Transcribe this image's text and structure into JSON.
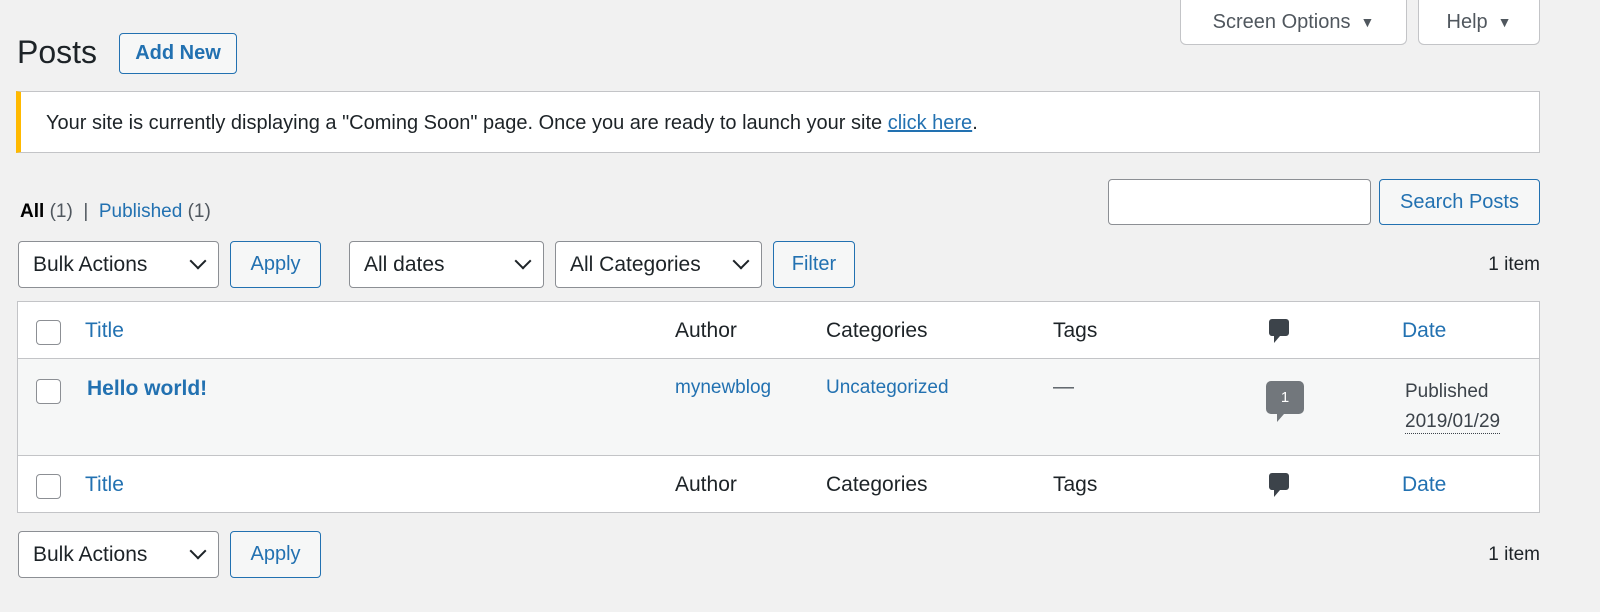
{
  "header": {
    "title": "Posts",
    "add_new": "Add New",
    "screen_options": "Screen Options",
    "help": "Help"
  },
  "notice": {
    "text": "Your site is currently displaying a \"Coming Soon\" page. Once you are ready to launch your site ",
    "link": "click here",
    "end": ".",
    "accent": "#ffb900"
  },
  "views": {
    "all": "All",
    "all_count": "(1)",
    "sep": "|",
    "published": "Published",
    "published_count": "(1)"
  },
  "search": {
    "value": "",
    "button": "Search Posts"
  },
  "top_nav": {
    "bulk": "Bulk Actions",
    "apply": "Apply",
    "dates": "All dates",
    "categories": "All Categories",
    "filter": "Filter",
    "count": "1 item"
  },
  "table": {
    "columns": {
      "title": "Title",
      "author": "Author",
      "categories": "Categories",
      "tags": "Tags",
      "date": "Date"
    },
    "rows": [
      {
        "title": "Hello world!",
        "author": "mynewblog",
        "categories": "Uncategorized",
        "tags": "—",
        "comments": "1",
        "status": "Published",
        "date": "2019/01/29"
      }
    ]
  },
  "bottom_nav": {
    "bulk": "Bulk Actions",
    "apply": "Apply",
    "count": "1 item"
  },
  "icons": {
    "comments": "comment-bubble-icon",
    "select": "chevron-down-icon"
  }
}
